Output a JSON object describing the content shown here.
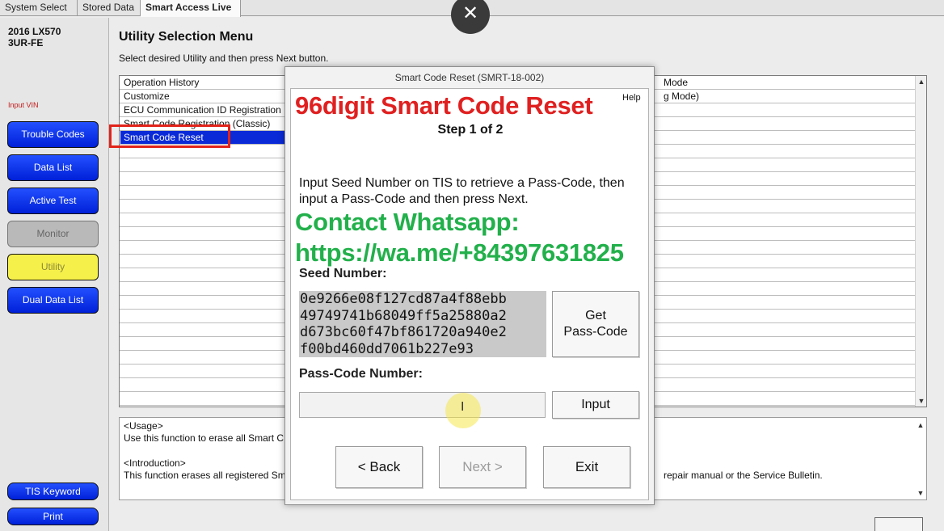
{
  "tabs": [
    {
      "label": "System Select",
      "active": false
    },
    {
      "label": "Stored Data",
      "active": false
    },
    {
      "label": "Smart Access Live",
      "active": true
    }
  ],
  "sidebar": {
    "vehicle_model": "2016 LX570",
    "vehicle_engine": "3UR-FE",
    "input_vin_label": "Input VIN",
    "buttons": [
      {
        "label": "Trouble Codes",
        "state": "enabled"
      },
      {
        "label": "Data List",
        "state": "enabled"
      },
      {
        "label": "Active Test",
        "state": "enabled"
      },
      {
        "label": "Monitor",
        "state": "disabled"
      },
      {
        "label": "Utility",
        "state": "active"
      },
      {
        "label": "Dual Data List",
        "state": "enabled"
      }
    ],
    "bottom_buttons": [
      {
        "label": "TIS Keyword"
      },
      {
        "label": "Print"
      }
    ]
  },
  "main": {
    "title": "Utility Selection Menu",
    "subtitle": "Select desired Utility and then press Next button.",
    "utilities": [
      {
        "label": "Operation History",
        "selected": false
      },
      {
        "label": "Customize",
        "selected": false
      },
      {
        "label": "ECU Communication ID Registration",
        "selected": false
      },
      {
        "label": "Smart Code Registration (Classic)",
        "selected": false
      },
      {
        "label": "Smart Code Reset",
        "selected": true
      }
    ],
    "right_column_fragments": [
      "Mode",
      "g Mode)"
    ],
    "usage": {
      "usage_heading": "<Usage>",
      "usage_text": "Use this function to erase all Smart C",
      "intro_heading": "<Introduction>",
      "intro_text": "This function erases all registered Sm",
      "intro_text_right": "repair manual or the Service Bulletin."
    }
  },
  "overlay": {
    "close_glyph": "✕"
  },
  "dialog": {
    "title": "Smart Code Reset (SMRT-18-002)",
    "overlay_heading": "96digit Smart Code Reset",
    "help_label": "Help",
    "step": "Step 1 of 2",
    "instruction": "Input Seed Number on TIS to retrieve a Pass-Code, then input a Pass-Code and then press Next.",
    "contact_line1": "Contact Whatsapp:",
    "contact_line2": "https://wa.me/+84397631825",
    "seed_label": "Seed Number:",
    "seed_lines": [
      "0e9266e08f127cd87a4f88ebb",
      "49749741b68049ff5a25880a2",
      "d673bc60f47bf861720a940e2",
      "f00bd460dd7061b227e93"
    ],
    "get_passcode_line1": "Get",
    "get_passcode_line2": "Pass-Code",
    "passcode_label": "Pass-Code Number:",
    "passcode_value": "",
    "input_button": "Input",
    "back_button": "< Back",
    "next_button": "Next >",
    "exit_button": "Exit",
    "cursor_glyph": "I"
  },
  "colors": {
    "brand_blue": "#0a2ad8",
    "highlight_red": "#e2231a",
    "heading_red": "#e02020",
    "contact_green": "#22b04b",
    "utility_yellow": "#f6f04a"
  }
}
